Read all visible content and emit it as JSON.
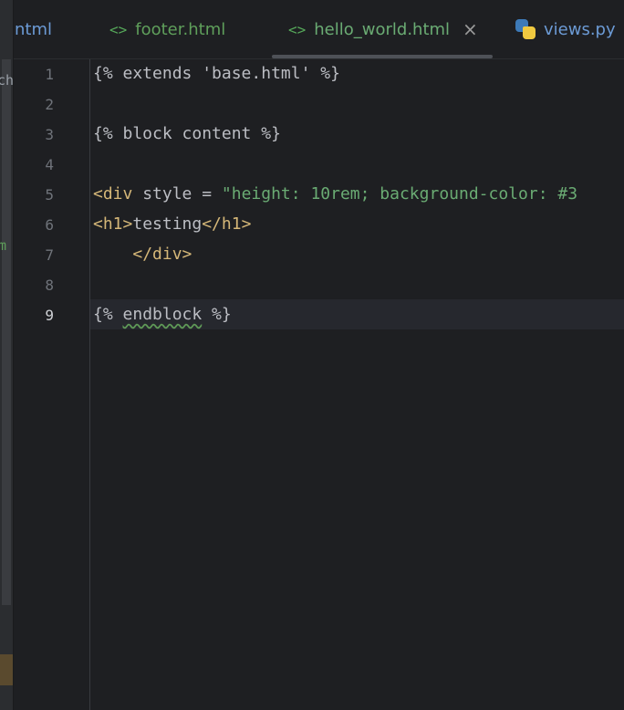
{
  "left_strip": {
    "fragments": [
      {
        "text": "ch",
        "color": "#9aa0a8"
      },
      {
        "text": "m",
        "color": "#5f9f5b"
      }
    ]
  },
  "tabs": [
    {
      "label": "ntml",
      "kind": "html",
      "icon": "",
      "active": false
    },
    {
      "label": "footer.html",
      "kind": "html",
      "icon": "<>",
      "active": false
    },
    {
      "label": "hello_world.html",
      "kind": "html",
      "icon": "<>",
      "active": true,
      "close": "×"
    },
    {
      "label": "views.py",
      "kind": "py",
      "icon": "python-icon",
      "active": false
    }
  ],
  "editor": {
    "current_line": 9,
    "lines": [
      {
        "n": "1",
        "tokens": [
          {
            "t": "{% extends 'base.html' %}",
            "c": "plain"
          }
        ]
      },
      {
        "n": "2",
        "tokens": []
      },
      {
        "n": "3",
        "tokens": [
          {
            "t": "{% block content %}",
            "c": "plain"
          }
        ]
      },
      {
        "n": "4",
        "tokens": []
      },
      {
        "n": "5",
        "tokens": [
          {
            "t": "<div",
            "c": "tag"
          },
          {
            "t": " style",
            "c": "attr"
          },
          {
            "t": " = ",
            "c": "plain"
          },
          {
            "t": "\"height: 10rem; background-color: #3",
            "c": "str"
          }
        ]
      },
      {
        "n": "6",
        "tokens": [
          {
            "t": "<h1>",
            "c": "tag"
          },
          {
            "t": "testing",
            "c": "plain"
          },
          {
            "t": "</h1>",
            "c": "tag"
          }
        ]
      },
      {
        "n": "7",
        "tokens": [
          {
            "t": "    ",
            "c": "plain"
          },
          {
            "t": "</div>",
            "c": "tag"
          }
        ]
      },
      {
        "n": "8",
        "tokens": []
      },
      {
        "n": "9",
        "tokens": [
          {
            "t": "{% ",
            "c": "plain"
          },
          {
            "t": "endblock",
            "c": "plain",
            "squiggle": true
          },
          {
            "t": " %}",
            "c": "plain"
          }
        ]
      }
    ]
  }
}
